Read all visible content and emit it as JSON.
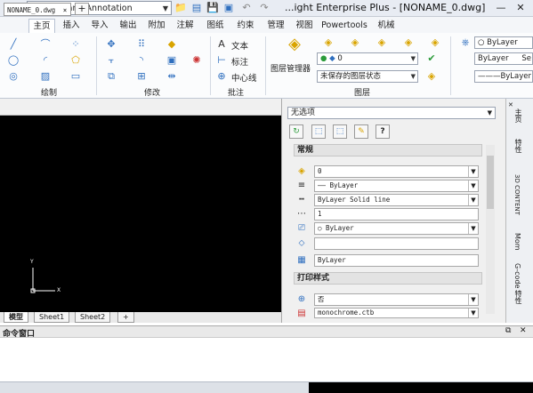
{
  "app": {
    "workspace": "Drafting and Annotation",
    "title": "...ight Enterprise Plus - [NONAME_0.dwg]"
  },
  "ribbon_tabs": [
    "主页",
    "插入",
    "导入",
    "输出",
    "附加",
    "注解",
    "图纸",
    "约束",
    "管理",
    "视图",
    "Powertools",
    "机械"
  ],
  "ribbon": {
    "groups": [
      "绘制",
      "修改",
      "批注",
      "图层"
    ],
    "annotation": {
      "text": "文本",
      "dimension": "标注",
      "centerline": "中心线"
    },
    "layer_manager": "图层管理器",
    "layer_combo": "0",
    "layer_state": "未保存的图层状态",
    "color": "ByLayer",
    "linetype": "ByLayer",
    "lineweight": "ByLayer",
    "props_right_small": "Se"
  },
  "document": {
    "tab_label": "NONAME_0.dwg",
    "close_glyph": "×",
    "new_tab_glyph": "+"
  },
  "canvas": {
    "ucs_x": "X",
    "ucs_y": "Y"
  },
  "layout_tabs": [
    "模型",
    "Sheet1",
    "Sheet2",
    "+"
  ],
  "properties": {
    "selection": "无选项",
    "sections": {
      "general": "常规",
      "print_style": "打印样式"
    },
    "general_fields": [
      {
        "icon": "layer-icon",
        "value": "0"
      },
      {
        "icon": "color-icon",
        "value": "—— ByLayer"
      },
      {
        "icon": "linetype-icon",
        "value": "ByLayer     Solid line"
      },
      {
        "icon": "ltscale-icon",
        "value": "1"
      },
      {
        "icon": "lineweight-icon",
        "value": "○ ByLayer"
      },
      {
        "icon": "hyperlink-icon",
        "value": ""
      },
      {
        "icon": "transparency-icon",
        "value": "ByLayer"
      }
    ],
    "print_fields": [
      {
        "icon": "print-style-icon",
        "value": "否"
      },
      {
        "icon": "plot-table-icon",
        "value": "monochrome.ctb"
      }
    ]
  },
  "side_tabs": [
    "主页",
    "特性",
    "3D CONTENT",
    "Mom",
    "G-code",
    "特性"
  ],
  "command_window": {
    "title": "命令窗口"
  }
}
